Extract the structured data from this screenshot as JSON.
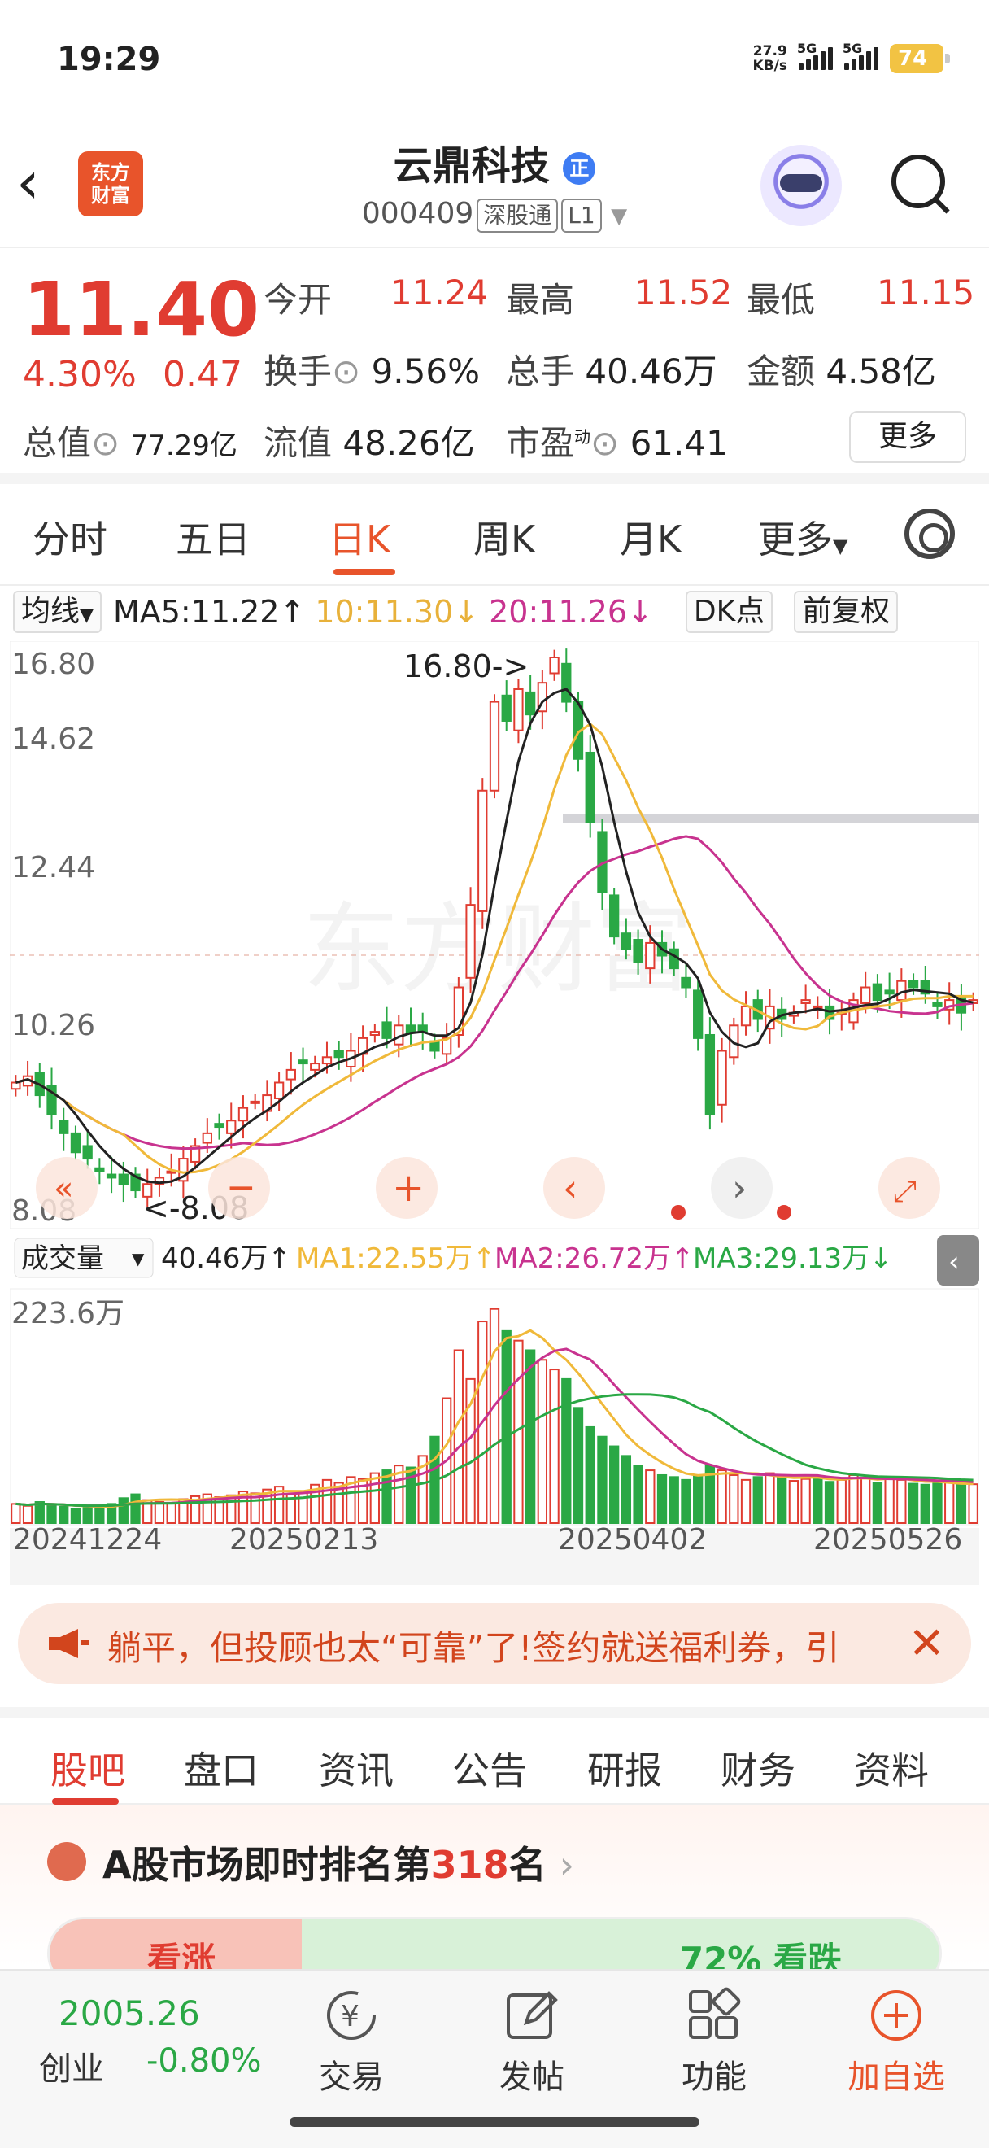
{
  "status": {
    "time": "19:29",
    "net_speed_value": "27.9",
    "net_speed_unit": "KB/s",
    "sig1": "5G",
    "sig2": "5G",
    "battery": "74"
  },
  "header": {
    "stock_name": "云鼎科技",
    "zheng": "正",
    "code": "000409",
    "market_tag": "深股通",
    "level_tag": "L1",
    "logo_line1": "东方",
    "logo_line2": "财富"
  },
  "quote": {
    "price": "11.40",
    "change_pct": "4.30%",
    "change_amt": "0.47",
    "open_label": "今开",
    "open": "11.24",
    "high_label": "最高",
    "high": "11.52",
    "low_label": "最低",
    "low": "11.15",
    "turnover_label": "换手",
    "turnover": "9.56%",
    "volume_label": "总手",
    "volume": "40.46万",
    "amount_label": "金额",
    "amount": "4.58亿",
    "mktcap_label": "总值",
    "mktcap": "77.29亿",
    "float_label": "流值",
    "float": "48.26亿",
    "pe_label": "市盈",
    "pe_sup": "动",
    "pe": "61.41",
    "more": "更多"
  },
  "tabs": [
    "分时",
    "五日",
    "日K",
    "周K",
    "月K",
    "更多"
  ],
  "ma": {
    "type": "均线",
    "ma5": "MA5:11.22",
    "ma10": "10:11.30",
    "ma20": "20:11.26",
    "dk": "DK点",
    "adjust": "前复权"
  },
  "colors": {
    "up": "#e03c31",
    "down": "#2aa845",
    "ma5": "#222222",
    "ma10": "#f0b93a",
    "ma20": "#c8338f",
    "accent": "#e8542b"
  },
  "chart": {
    "y_labels": [
      "16.80",
      "14.62",
      "12.44",
      "10.26",
      "8.08"
    ],
    "high_annot": "16.80->",
    "low_annot": "<-8.08",
    "watermark": "东方财富",
    "vol_label": "成交量",
    "vol_value": "40.46万",
    "vol_ma1": "MA1:22.55万",
    "vol_ma2": "MA2:26.72万",
    "vol_ma3": "MA3:29.13万",
    "vol_max": "223.6万",
    "dates": [
      "20241224",
      "20250213",
      "20250402",
      "20250526"
    ]
  },
  "chart_data": {
    "type": "candlestick",
    "ylim": [
      8.08,
      16.8
    ],
    "closes": [
      10.1,
      10.2,
      9.9,
      9.6,
      9.3,
      9.0,
      8.9,
      8.7,
      8.6,
      8.5,
      8.4,
      8.5,
      8.6,
      8.7,
      8.9,
      9.1,
      9.3,
      9.4,
      9.5,
      9.7,
      9.8,
      9.9,
      10.1,
      10.3,
      10.4,
      10.4,
      10.5,
      10.5,
      10.6,
      10.8,
      10.9,
      10.8,
      11.0,
      10.9,
      10.9,
      10.6,
      10.8,
      11.6,
      12.9,
      14.7,
      16.1,
      15.8,
      16.3,
      15.9,
      16.4,
      16.8,
      16.1,
      15.2,
      14.2,
      13.1,
      12.4,
      12.2,
      12.0,
      12.3,
      12.1,
      11.9,
      11.6,
      10.8,
      9.6,
      10.6,
      11.0,
      11.3,
      11.1,
      11.3,
      11.1,
      11.2,
      11.4,
      11.3,
      11.1,
      11.2,
      11.4,
      11.6,
      11.4,
      11.5,
      11.7,
      11.6,
      11.5,
      11.3,
      11.4,
      11.2,
      11.4
    ],
    "volumes_wan": [
      20,
      18,
      22,
      19,
      17,
      15,
      16,
      18,
      20,
      26,
      30,
      24,
      22,
      21,
      25,
      28,
      30,
      27,
      29,
      33,
      31,
      35,
      38,
      30,
      32,
      40,
      45,
      42,
      48,
      46,
      52,
      55,
      60,
      58,
      70,
      90,
      130,
      180,
      150,
      210,
      223,
      200,
      190,
      180,
      170,
      160,
      150,
      120,
      100,
      90,
      80,
      70,
      60,
      55,
      50,
      48,
      45,
      50,
      60,
      55,
      50,
      45,
      48,
      52,
      47,
      44,
      46,
      49,
      43,
      45,
      50,
      47,
      42,
      48,
      45,
      41,
      40,
      42,
      43,
      40,
      40.5
    ],
    "ma5_vol": "22.55万",
    "ma10_vol": "26.72万",
    "ma20_vol": "29.13万"
  },
  "notice": {
    "text": "躺平，但投顾也太“可靠”了!签约就送福利券，引"
  },
  "subtabs": [
    "股吧",
    "盘口",
    "资讯",
    "公告",
    "研报",
    "财务",
    "资料"
  ],
  "rank": {
    "prefix": "A股市场即时排名第",
    "num": "318",
    "suffix": "名",
    "up_label": "看涨",
    "down_label": "72% 看跌"
  },
  "bottom": {
    "index_value": "2005.26",
    "index_name": "创业",
    "index_change": "-0.80%",
    "nav": [
      "交易",
      "发帖",
      "功能",
      "加自选"
    ]
  }
}
